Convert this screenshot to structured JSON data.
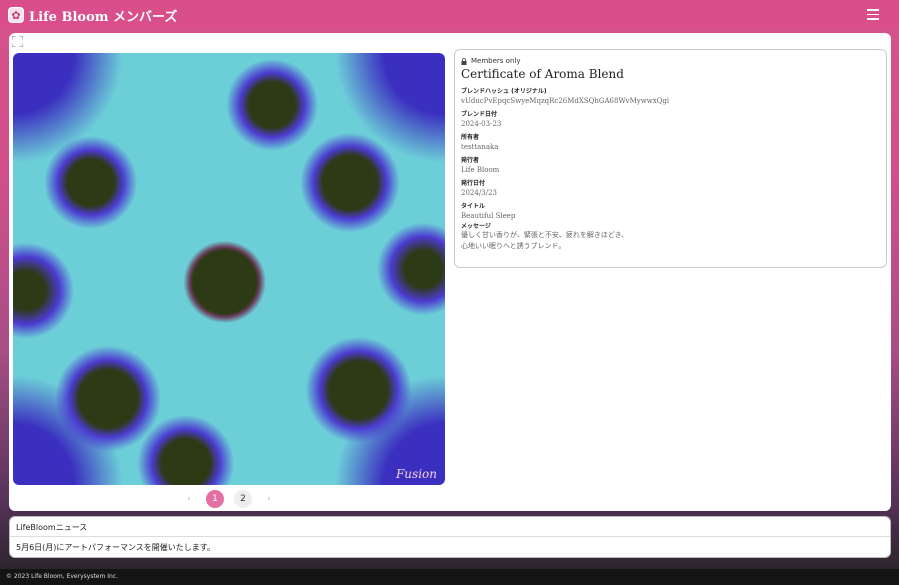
{
  "header": {
    "logo_glyph": "✿",
    "title": "Life Bloom メンバーズ"
  },
  "colors": {
    "header_bg": "#d84f8c",
    "active_page": "#e36fa6",
    "art_background": "#6ccfd8"
  },
  "artwork": {
    "signature": "Fusion"
  },
  "pager": {
    "prev": "‹",
    "next": "›",
    "pages": [
      "1",
      "2"
    ],
    "current": "1"
  },
  "certificate": {
    "badge": "Members only",
    "title": "Certificate of Aroma Blend",
    "fields": [
      {
        "label": "ブレンドハッシュ (オリジナル)",
        "value": "vUducPvEpqcSwyeMqzqRc26MdXSQhGA68WvMywwxQgi"
      },
      {
        "label": "ブレンド日付",
        "value": "2024-03-23"
      },
      {
        "label": "所有者",
        "value": "testtanaka"
      },
      {
        "label": "発行者",
        "value": "Life Bloom"
      },
      {
        "label": "発行日付",
        "value": "2024/3/23"
      },
      {
        "label": "タイトル",
        "value": "Beautiful Sleep"
      }
    ],
    "message_label": "メッセージ",
    "message_lines": [
      "優しく甘い香りが、緊張と不安、疲れを解きほどき、",
      "心地いい眠りへと誘うブレンド。"
    ]
  },
  "news": {
    "title": "LifeBloomニュース",
    "items": [
      "5月6日(月)にアートパフォーマンスを開催いたします。"
    ]
  },
  "footer": {
    "copyright": "© 2023 Life Bloom, Everysystem Inc."
  }
}
